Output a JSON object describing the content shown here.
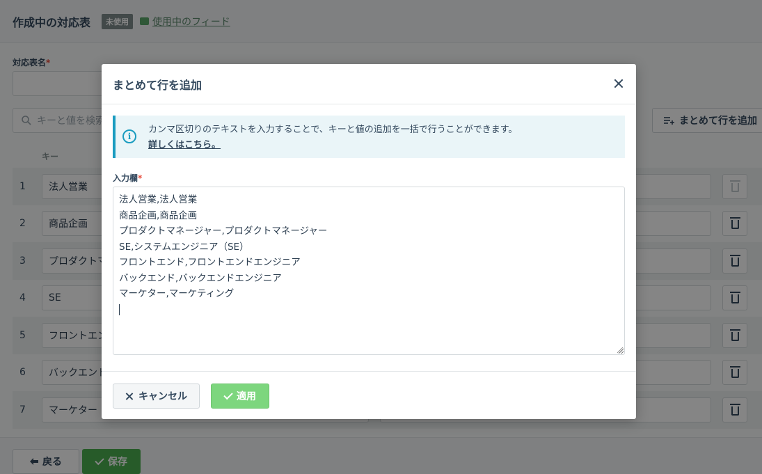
{
  "header": {
    "title": "作成中の対応表",
    "status_badge": "未使用",
    "feed_link": "使用中のフィード"
  },
  "form": {
    "name_label": "対応表名",
    "required_mark": "*",
    "search_placeholder": "キーと値を検索",
    "bulk_add_button": "まとめて行を追加",
    "key_column_header": "キー"
  },
  "rows": [
    {
      "num": "1",
      "key": "法人営業"
    },
    {
      "num": "2",
      "key": "商品企画"
    },
    {
      "num": "3",
      "key": "プロダクトマ"
    },
    {
      "num": "4",
      "key": "SE"
    },
    {
      "num": "5",
      "key": "フロントエン"
    },
    {
      "num": "6",
      "key": "バックエンド"
    },
    {
      "num": "7",
      "key": "マーケター"
    }
  ],
  "footer": {
    "back_button": "戻る",
    "save_button": "保存"
  },
  "modal": {
    "title": "まとめて行を追加",
    "info_text": "カンマ区切りのテキストを入力することで、キーと値の追加を一括で行うことができます。",
    "info_link": "詳しくはこちら。",
    "input_label": "入力欄",
    "required_mark": "*",
    "textarea_lines": [
      "法人営業,法人営業",
      "商品企画,商品企画",
      "プロダクトマネージャー,プロダクトマネージャー",
      "SE,システムエンジニア（SE）",
      "フロントエンド,フロントエンドエンジニア",
      "バックエンド,バックエンドエンジニア",
      "マーケター,マーケティング"
    ],
    "cancel_button": "キャンセル",
    "apply_button": "適用"
  },
  "colors": {
    "info_accent": "#1a9cc0",
    "apply_green": "#7dd67e",
    "save_green": "#4caf50",
    "required_red": "#e74c3c"
  }
}
